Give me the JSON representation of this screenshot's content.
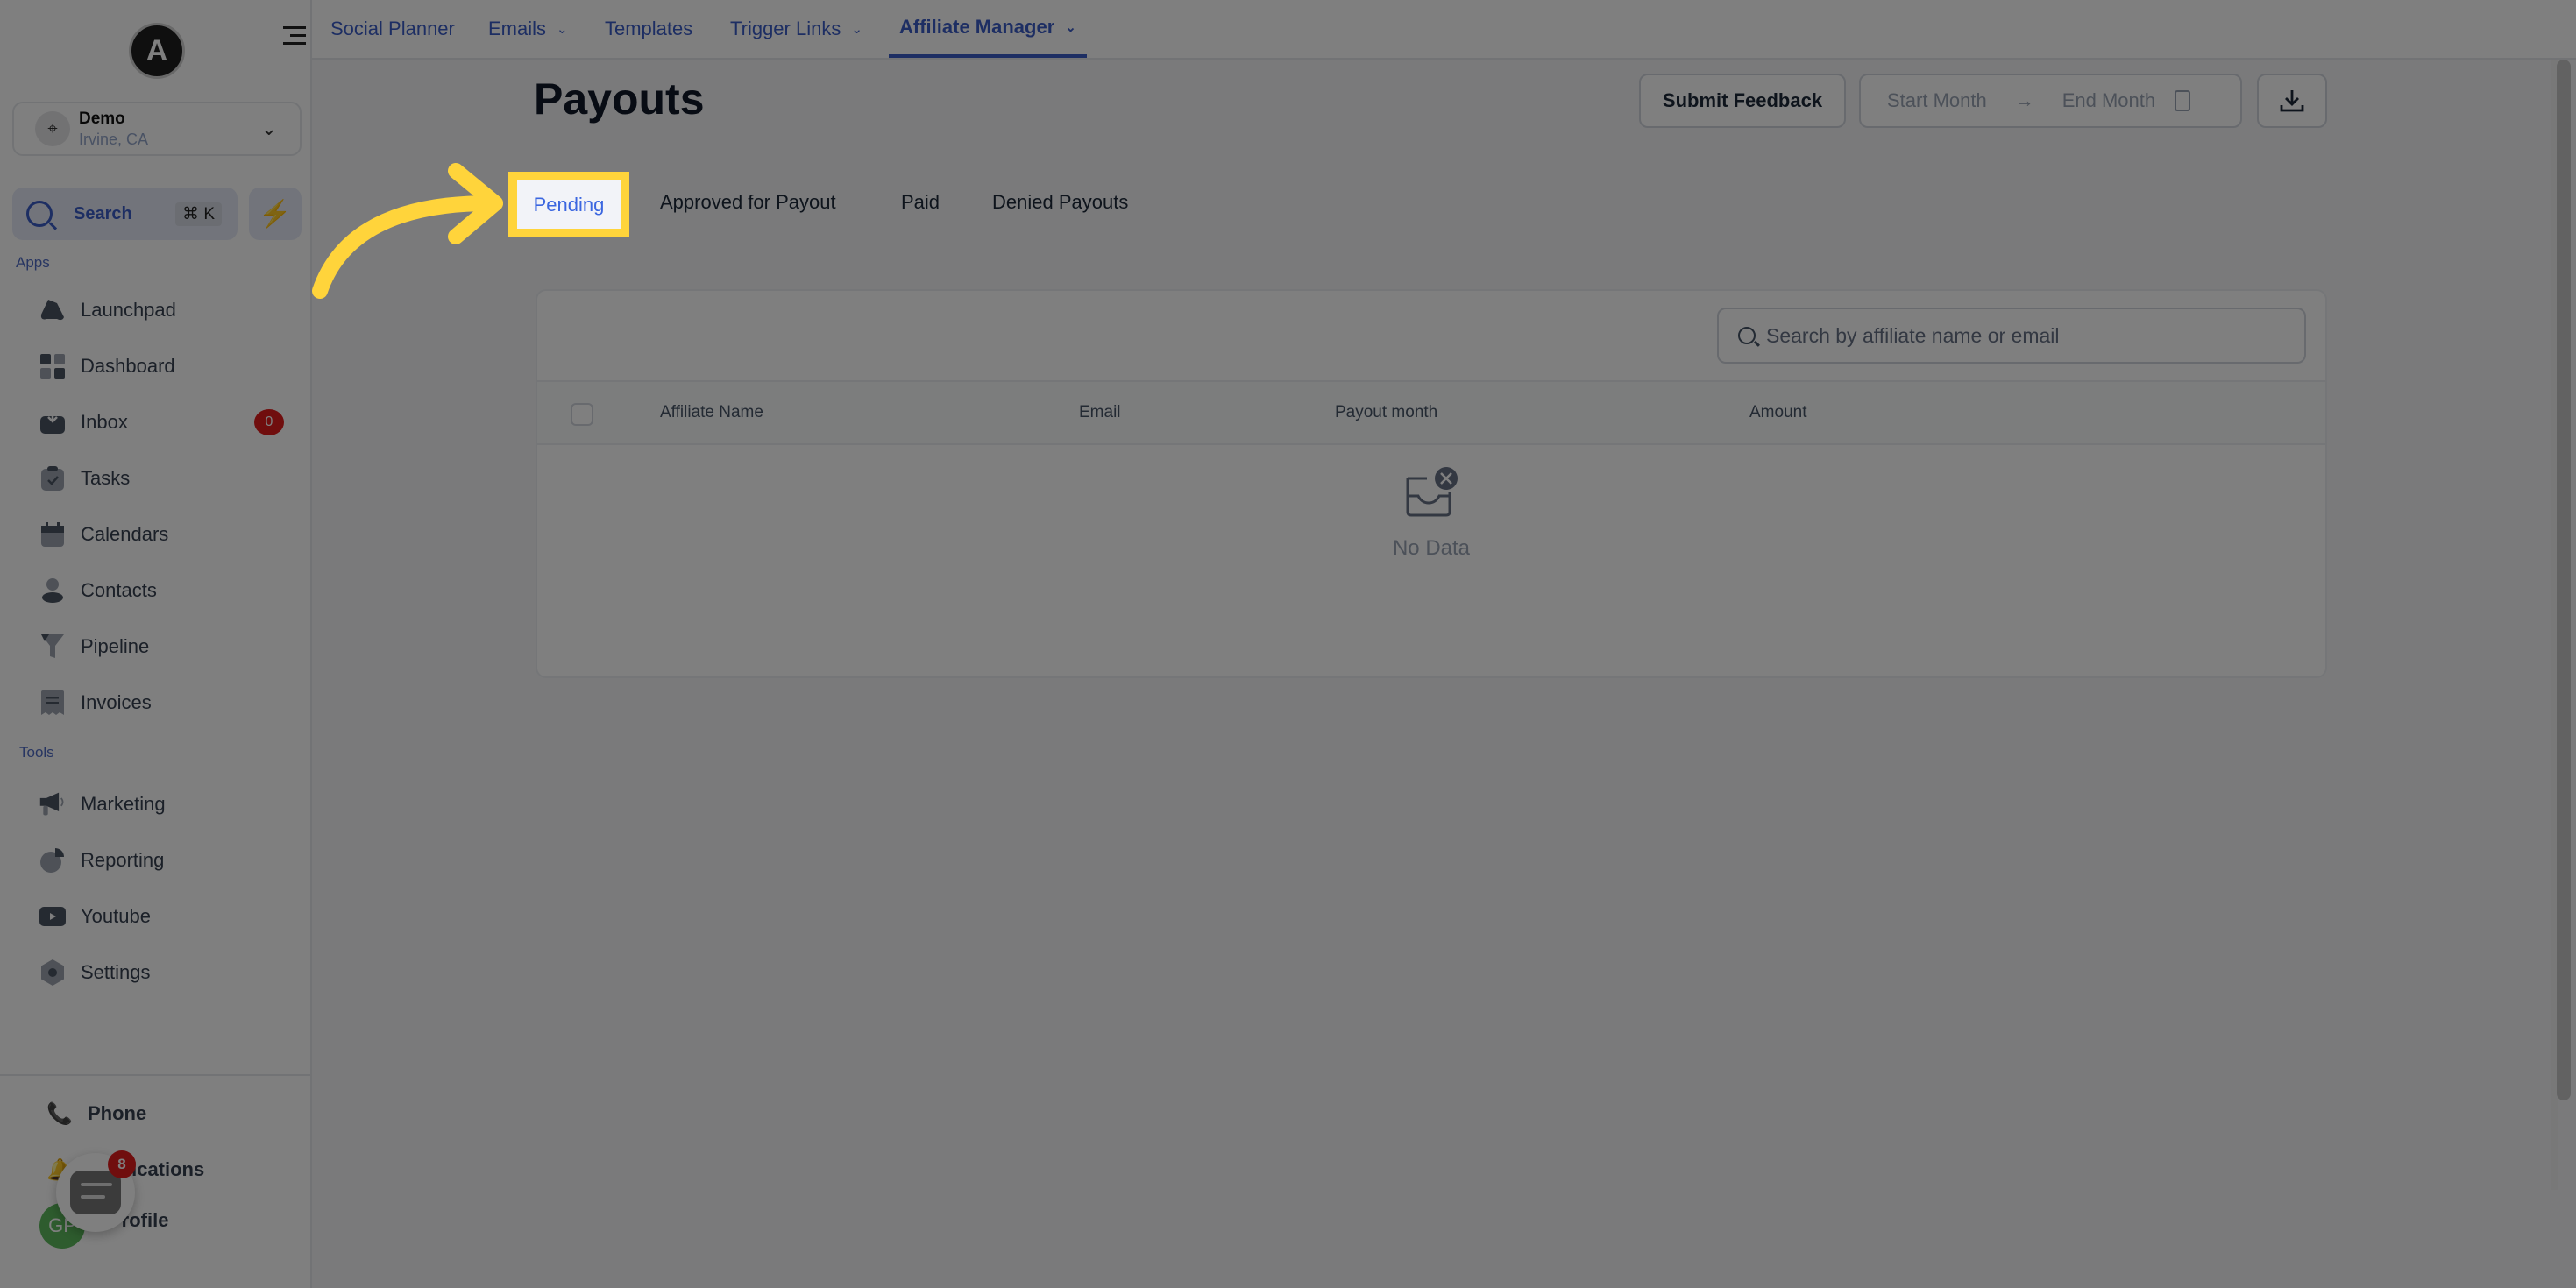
{
  "sidebar": {
    "logo_letter": "A",
    "location": {
      "name": "Demo",
      "sub": "Irvine, CA"
    },
    "search": {
      "label": "Search",
      "shortcut": "⌘ K"
    },
    "apps_label": "Apps",
    "apps": [
      {
        "label": "Launchpad",
        "icon": "launchpad-icon"
      },
      {
        "label": "Dashboard",
        "icon": "dashboard-icon"
      },
      {
        "label": "Inbox",
        "icon": "inbox-icon",
        "badge": "0"
      },
      {
        "label": "Tasks",
        "icon": "tasks-icon"
      },
      {
        "label": "Calendars",
        "icon": "calendar-icon"
      },
      {
        "label": "Contacts",
        "icon": "contacts-icon"
      },
      {
        "label": "Pipeline",
        "icon": "pipeline-icon"
      },
      {
        "label": "Invoices",
        "icon": "invoices-icon"
      }
    ],
    "tools_label": "Tools",
    "tools": [
      {
        "label": "Marketing",
        "icon": "megaphone-icon"
      },
      {
        "label": "Reporting",
        "icon": "pie-chart-icon"
      },
      {
        "label": "Youtube",
        "icon": "youtube-icon"
      },
      {
        "label": "Settings",
        "icon": "settings-icon"
      }
    ],
    "bottom": [
      {
        "label": "Phone",
        "icon": "phone-icon"
      },
      {
        "label": "Notifications",
        "icon": "bell-icon"
      },
      {
        "label": "Profile",
        "icon": "avatar"
      }
    ],
    "profile_initials": "GP",
    "chat_badge": "8"
  },
  "topnav": {
    "items": [
      {
        "label": "Social Planner",
        "dropdown": false,
        "active": false
      },
      {
        "label": "Emails",
        "dropdown": true,
        "active": false
      },
      {
        "label": "Templates",
        "dropdown": false,
        "active": false
      },
      {
        "label": "Trigger Links",
        "dropdown": true,
        "active": false
      },
      {
        "label": "Affiliate Manager",
        "dropdown": true,
        "active": true
      }
    ]
  },
  "page": {
    "title": "Payouts",
    "submit_feedback": "Submit Feedback",
    "date_range": {
      "start_placeholder": "Start Month",
      "end_placeholder": "End Month"
    },
    "tabs": [
      {
        "label": "Pending",
        "active": true
      },
      {
        "label": "Approved for Payout",
        "active": false
      },
      {
        "label": "Paid",
        "active": false
      },
      {
        "label": "Denied Payouts",
        "active": false
      }
    ],
    "table": {
      "search_placeholder": "Search by affiliate name or email",
      "columns": [
        "Affiliate Name",
        "Email",
        "Payout month",
        "Amount"
      ],
      "rows": [],
      "empty_text": "No Data"
    }
  },
  "colors": {
    "accent": "#3b5cc6",
    "highlight": "#ffd43b",
    "badge": "#e11d1d",
    "overlay": "rgba(0,0,0,0.5)"
  }
}
